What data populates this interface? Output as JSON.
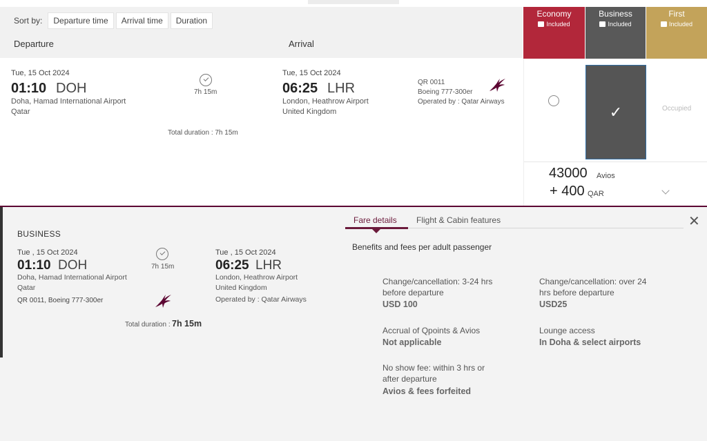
{
  "sort": {
    "label": "Sort by:",
    "options": [
      "Departure time",
      "Arrival time",
      "Duration"
    ]
  },
  "columns": {
    "departure": "Departure",
    "arrival": "Arrival"
  },
  "cabins": [
    {
      "name": "Economy",
      "included": "Included",
      "color": "#b2273a"
    },
    {
      "name": "Business",
      "included": "Included",
      "color": "#595959"
    },
    {
      "name": "First",
      "included": "Included",
      "color": "#c3a35a"
    }
  ],
  "flight": {
    "dep_date": "Tue, 15 Oct 2024",
    "dep_time": "01:10",
    "dep_code": "DOH",
    "dep_airport": "Doha, Hamad International Airport",
    "dep_country": "Qatar",
    "duration": "7h 15m",
    "total_duration": "Total duration : 7h 15m",
    "arr_date": "Tue, 15 Oct 2024",
    "arr_time": "06:25",
    "arr_code": "LHR",
    "arr_airport": "London, Heathrow Airport",
    "arr_country": "United Kingdom",
    "flight_no": "QR 0011",
    "aircraft": "Boeing 777-300er",
    "operated": "Operated by : Qatar Airways"
  },
  "selection": {
    "selected_cabin": "Business",
    "first_status": "Occupied",
    "price_avios": "43000",
    "price_avios_unit": "Avios",
    "price_cash": "+ 400",
    "price_cash_unit": "QAR"
  },
  "details": {
    "cabin": "BUSINESS",
    "dep_date": "Tue , 15 Oct 2024",
    "dep_time": "01:10",
    "dep_code": "DOH",
    "dep_airport": "Doha, Hamad International Airport",
    "dep_country": "Qatar",
    "flight_info": "QR 0011, Boeing 777-300er",
    "duration": "7h 15m",
    "total_duration_label": "Total duration :",
    "total_duration_value": "7h 15m",
    "arr_date": "Tue , 15 Oct 2024",
    "arr_time": "06:25",
    "arr_code": "LHR",
    "arr_airport": "London, Heathrow Airport",
    "arr_country": "United Kingdom",
    "operated": "Operated by : Qatar Airways"
  },
  "tabs": {
    "fare": "Fare details",
    "cabin": "Flight & Cabin features"
  },
  "fares": {
    "intro": "Benefits and fees per adult passenger",
    "items": [
      {
        "label": [
          "Change/cancellation: 3-24 hrs",
          "before departure"
        ],
        "value": "USD 100"
      },
      {
        "label": [
          "Change/cancellation: over 24",
          "hrs before departure"
        ],
        "value": "USD25"
      },
      {
        "label": [
          "Accrual of Qpoints & Avios"
        ],
        "value": "Not applicable"
      },
      {
        "label": [
          "Lounge access"
        ],
        "value": "In Doha & select airports"
      },
      {
        "label": [
          "No show fee: within 3 hrs or",
          "after departure"
        ],
        "value": "Avios & fees forfeited"
      }
    ]
  }
}
